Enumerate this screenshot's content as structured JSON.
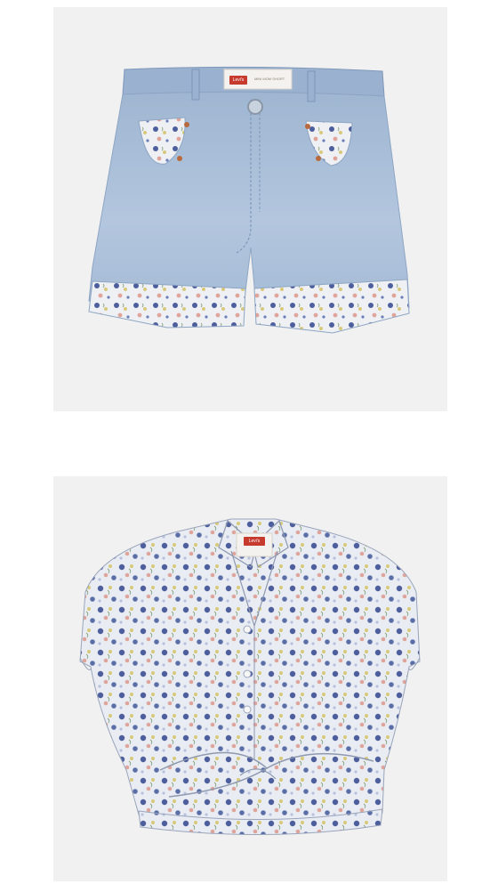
{
  "products": [
    {
      "name": "denim-shorts-floral-cuff",
      "brand_tab": "Levi's",
      "waistband_label": "MINI MOM SHORT"
    },
    {
      "name": "floral-knot-front-shirt",
      "brand_tab": "Levi's"
    }
  ],
  "colors": {
    "panel_bg": "#f1f1f1",
    "denim": "#a9bfd9",
    "denim_dark": "#8ea6c4",
    "floral_bg": "#eef0f4",
    "floral_blue": "#4d5e9c",
    "floral_yellow": "#d8c97a",
    "floral_pink": "#e0a59a",
    "tab_red": "#c63b2e",
    "rivet": "#b86a3e"
  }
}
